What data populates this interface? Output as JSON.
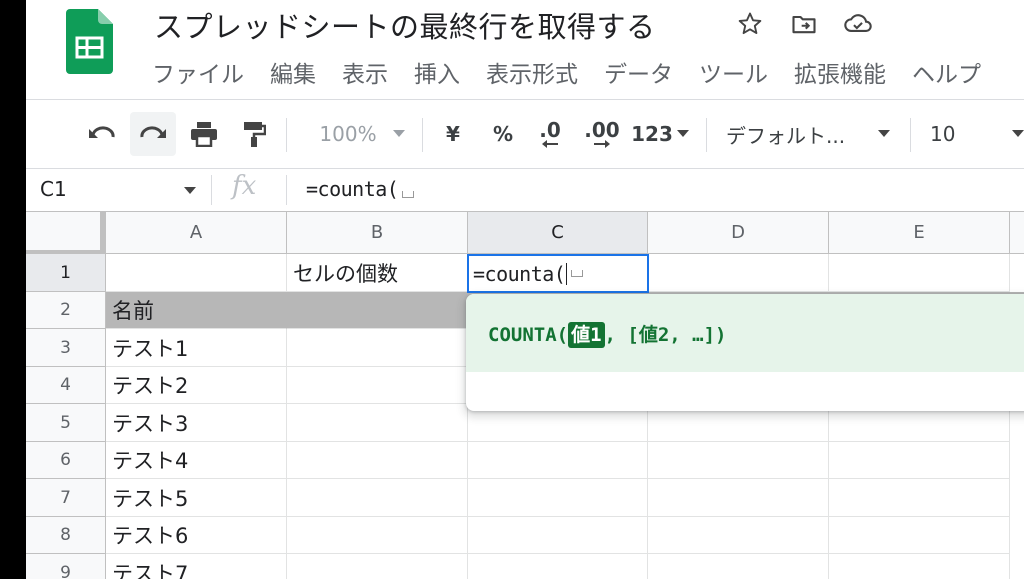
{
  "document": {
    "title": "スプレッドシートの最終行を取得する"
  },
  "title_icons": [
    "star-icon",
    "move-to-folder-icon",
    "cloud-status-icon"
  ],
  "menu": [
    "ファイル",
    "編集",
    "表示",
    "挿入",
    "表示形式",
    "データ",
    "ツール",
    "拡張機能",
    "ヘルプ"
  ],
  "toolbar": {
    "zoom": "100%",
    "currency": "¥",
    "percent": "%",
    "decrease_decimal": ".0",
    "increase_decimal": ".00",
    "number_format": "123",
    "font": "デフォルト...",
    "font_size": "10"
  },
  "formula_bar": {
    "name_box": "C1",
    "fx": "fx",
    "formula": "=counta("
  },
  "columns": [
    "A",
    "B",
    "C",
    "D",
    "E"
  ],
  "rows": [
    "1",
    "2",
    "3",
    "4",
    "5",
    "6",
    "7",
    "8",
    "9"
  ],
  "cells": {
    "B1": "セルの個数",
    "C1": "=counta(",
    "A2": "名前",
    "A3": "テスト1",
    "A4": "テスト2",
    "A5": "テスト3",
    "A6": "テスト4",
    "A7": "テスト5",
    "A8": "テスト6",
    "A9": "テスト7"
  },
  "autocomplete": {
    "func": "COUNTA(",
    "arg_highlight": "値1",
    "rest": ", [値2, …])"
  },
  "colors": {
    "accent": "#1a73e8",
    "sheets_green": "#0f9d58",
    "suggest_bg": "#e6f4ea",
    "suggest_text": "#137333",
    "header_gray": "#b7b7b7"
  }
}
